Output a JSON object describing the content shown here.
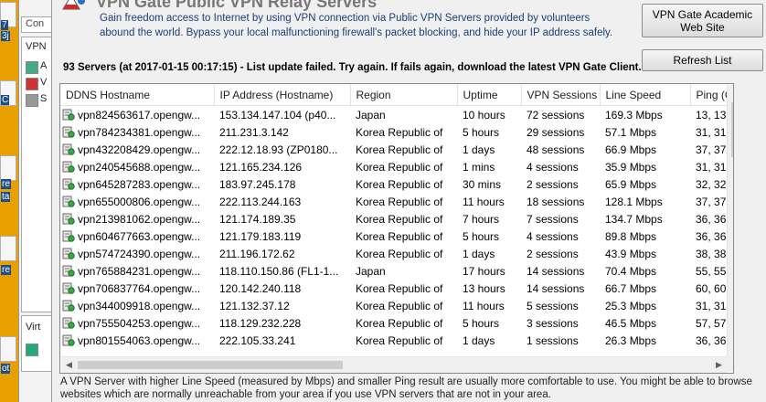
{
  "background": {
    "desktop_icon_labels": [
      "7",
      "3j",
      "C",
      "re",
      "ta",
      "re",
      "ot"
    ],
    "window_tab": "Con",
    "window_panel_label": "VPN",
    "window_items": [
      "A",
      "V",
      "S"
    ],
    "window_lower_label": "Virt"
  },
  "dialog": {
    "title": "VPN Gate Public VPN Relay Servers",
    "description": "Gain freedom access to Internet by using VPN connection via Public VPN Servers provided by volunteers abound the world. Bypass your local malfunctioning firewall's packet blocking, and hide your IP address safely.",
    "academic_button": "VPN Gate Academic Web Site",
    "refresh_button": "Refresh List",
    "status": "93 Servers (at 2017-01-15 00:17:15) - List update failed. Try again. If fails again, download the latest VPN Gate Client.",
    "footer": "A VPN Server with higher Line Speed (measured by Mbps) and smaller Ping result are usually more comfortable to use. You might be able to browse websites which are normally unreachable from your area if you use VPN servers that are not in your area."
  },
  "columns": [
    "DDNS Hostname",
    "IP Address (Hostname)",
    "Region",
    "Uptime",
    "VPN Sessions",
    "Line Speed",
    "Ping (G"
  ],
  "servers": [
    {
      "host": "vpn824563617.opengw...",
      "ip": "153.134.147.104 (p40...",
      "region": "Japan",
      "uptime": "10 hours",
      "sessions": "72 sessions",
      "speed": "169.3 Mbps",
      "ping": "13, 13"
    },
    {
      "host": "vpn784234381.opengw...",
      "ip": "211.231.3.142",
      "region": "Korea Republic of",
      "uptime": "5 hours",
      "sessions": "29 sessions",
      "speed": "57.1 Mbps",
      "ping": "31, 31"
    },
    {
      "host": "vpn432208429.opengw...",
      "ip": "222.12.18.93 (ZP0180...",
      "region": "Korea Republic of",
      "uptime": "1 days",
      "sessions": "48 sessions",
      "speed": "66.9 Mbps",
      "ping": "37, 37"
    },
    {
      "host": "vpn240545688.opengw...",
      "ip": "121.165.234.126",
      "region": "Korea Republic of",
      "uptime": "1 mins",
      "sessions": "4 sessions",
      "speed": "35.9 Mbps",
      "ping": "31, 31"
    },
    {
      "host": "vpn645287283.opengw...",
      "ip": "183.97.245.178",
      "region": "Korea Republic of",
      "uptime": "30 mins",
      "sessions": "2 sessions",
      "speed": "65.9 Mbps",
      "ping": "32, 32"
    },
    {
      "host": "vpn655000806.opengw...",
      "ip": "222.113.244.163",
      "region": "Korea Republic of",
      "uptime": "11 hours",
      "sessions": "18 sessions",
      "speed": "128.1 Mbps",
      "ping": "37, 37"
    },
    {
      "host": "vpn213981062.opengw...",
      "ip": "121.174.189.35",
      "region": "Korea Republic of",
      "uptime": "7 hours",
      "sessions": "7 sessions",
      "speed": "134.7 Mbps",
      "ping": "36, 36"
    },
    {
      "host": "vpn604677663.opengw...",
      "ip": "121.179.183.119",
      "region": "Korea Republic of",
      "uptime": "5 hours",
      "sessions": "4 sessions",
      "speed": "89.8 Mbps",
      "ping": "36, 36"
    },
    {
      "host": "vpn574724390.opengw...",
      "ip": "211.196.172.62",
      "region": "Korea Republic of",
      "uptime": "1 days",
      "sessions": "2 sessions",
      "speed": "43.9 Mbps",
      "ping": "38, 38"
    },
    {
      "host": "vpn765884231.opengw...",
      "ip": "118.110.150.86 (FL1-1...",
      "region": "Japan",
      "uptime": "17 hours",
      "sessions": "14 sessions",
      "speed": "70.4 Mbps",
      "ping": "55, 55"
    },
    {
      "host": "vpn706837764.opengw...",
      "ip": "120.142.240.118",
      "region": "Korea Republic of",
      "uptime": "13 hours",
      "sessions": "14 sessions",
      "speed": "66.7 Mbps",
      "ping": "60, 60"
    },
    {
      "host": "vpn344009918.opengw...",
      "ip": "121.132.37.12",
      "region": "Korea Republic of",
      "uptime": "11 hours",
      "sessions": "5 sessions",
      "speed": "25.3 Mbps",
      "ping": "31, 31"
    },
    {
      "host": "vpn755504253.opengw...",
      "ip": "118.129.232.228",
      "region": "Korea Republic of",
      "uptime": "5 hours",
      "sessions": "3 sessions",
      "speed": "46.5 Mbps",
      "ping": "57, 57"
    },
    {
      "host": "vpn801554063.opengw...",
      "ip": "222.105.33.241",
      "region": "Korea Republic of",
      "uptime": "1 days",
      "sessions": "1 sessions",
      "speed": "26.3 Mbps",
      "ping": "36, 36"
    }
  ]
}
